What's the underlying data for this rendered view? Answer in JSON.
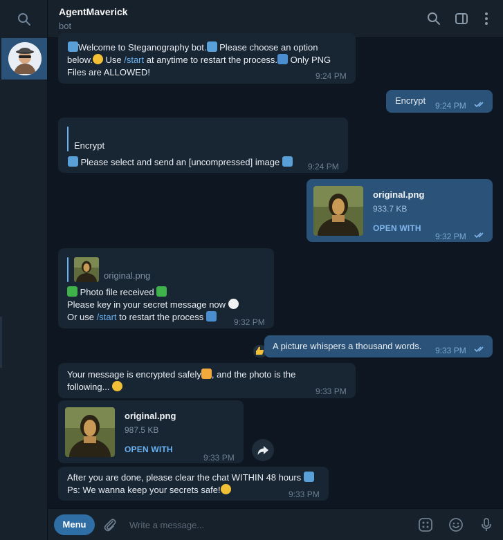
{
  "header": {
    "title": "AgentMaverick",
    "subtitle": "bot"
  },
  "messages": {
    "m1": {
      "line1a": "Welcome to Steganography bot.",
      "line1b": "Please choose an option",
      "line2a": "below.",
      "line2b": " Use ",
      "line2_link": "/start",
      "line2c": " at anytime to restart the process.",
      "line2d": " Only PNG",
      "line3": "Files are ALLOWED!",
      "time": "9:24 PM"
    },
    "m2": {
      "text": "Encrypt",
      "time": "9:24 PM"
    },
    "m3": {
      "quote": "Encrypt",
      "text": "Please select and send an [uncompressed] image",
      "time": "9:24 PM"
    },
    "m4": {
      "file_name": "original.png",
      "file_size": "933.7 KB",
      "action": "OPEN WITH",
      "time": "9:32 PM"
    },
    "m5": {
      "reply_file": "original.png",
      "line1": "Photo file received",
      "line2": "Please key in your secret message now",
      "line3a": "Or use ",
      "line3_link": "/start",
      "line3b": " to restart the process",
      "time": "9:32 PM"
    },
    "m6": {
      "text": "A picture whispers a thousand words.",
      "time": "9:33 PM"
    },
    "m7": {
      "line1a": "Your message is encrypted safely",
      "line1b": ", and the photo is the",
      "line2": "following...",
      "time": "9:33 PM"
    },
    "m8": {
      "file_name": "original.png",
      "file_size": "987.5 KB",
      "action": "OPEN WITH",
      "time": "9:33 PM"
    },
    "m9": {
      "line1": "After you are done, please clear the chat WITHIN 48 hours",
      "line2": "Ps: We wanna keep your secrets safe!",
      "time": "9:33 PM"
    }
  },
  "composer": {
    "menu_label": "Menu",
    "placeholder": "Write a message..."
  },
  "colors": {
    "background": "#0e1621",
    "panel": "#17212b",
    "incoming_bubble": "#182533",
    "outgoing_bubble": "#2b5278",
    "accent": "#6ab3f3"
  },
  "icons": [
    "search-icon",
    "sidebar-toggle-icon",
    "more-vert-icon",
    "attach-icon",
    "emoji-icon",
    "sticker-icon",
    "mic-icon",
    "forward-icon",
    "double-check-icon",
    "thumbs-up-icon"
  ]
}
